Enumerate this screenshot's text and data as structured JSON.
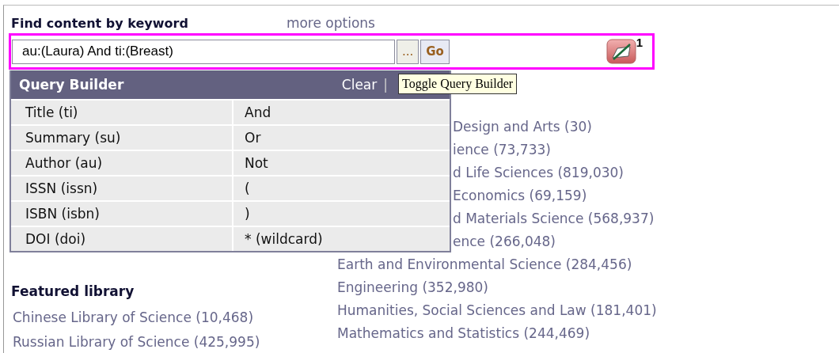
{
  "heading": "Find content by keyword",
  "more_options": "more options",
  "search": {
    "value": "au:(Laura) And ti:(Breast)",
    "browse_button": "...",
    "go_button": "Go",
    "icon_badge": "1"
  },
  "query_builder": {
    "title": "Query Builder",
    "clear": "Clear",
    "separator": "|",
    "tooltip": "Toggle Query Builder",
    "rows": [
      {
        "field": "Title (ti)",
        "operator": "And"
      },
      {
        "field": "Summary (su)",
        "operator": "Or"
      },
      {
        "field": "Author (au)",
        "operator": "Not"
      },
      {
        "field": "ISSN (issn)",
        "operator": "("
      },
      {
        "field": "ISBN (isbn)",
        "operator": ")"
      },
      {
        "field": "DOI (doi)",
        "operator": "* (wildcard)"
      }
    ]
  },
  "subjects_partly_hidden": [
    "Design and Arts (30)",
    "ience (73,733)",
    "d Life Sciences (819,030)",
    "Economics (69,159)",
    "d Materials Science (568,937)",
    "ence (266,048)"
  ],
  "subjects": [
    "Earth and Environmental Science (284,456)",
    "Engineering (352,980)",
    "Humanities, Social Sciences and Law (181,401)",
    "Mathematics and Statistics (244,469)"
  ],
  "featured_library": {
    "heading": "Featured library",
    "links": [
      "Chinese Library of Science (10,468)",
      "Russian Library of Science (425,995)"
    ]
  }
}
